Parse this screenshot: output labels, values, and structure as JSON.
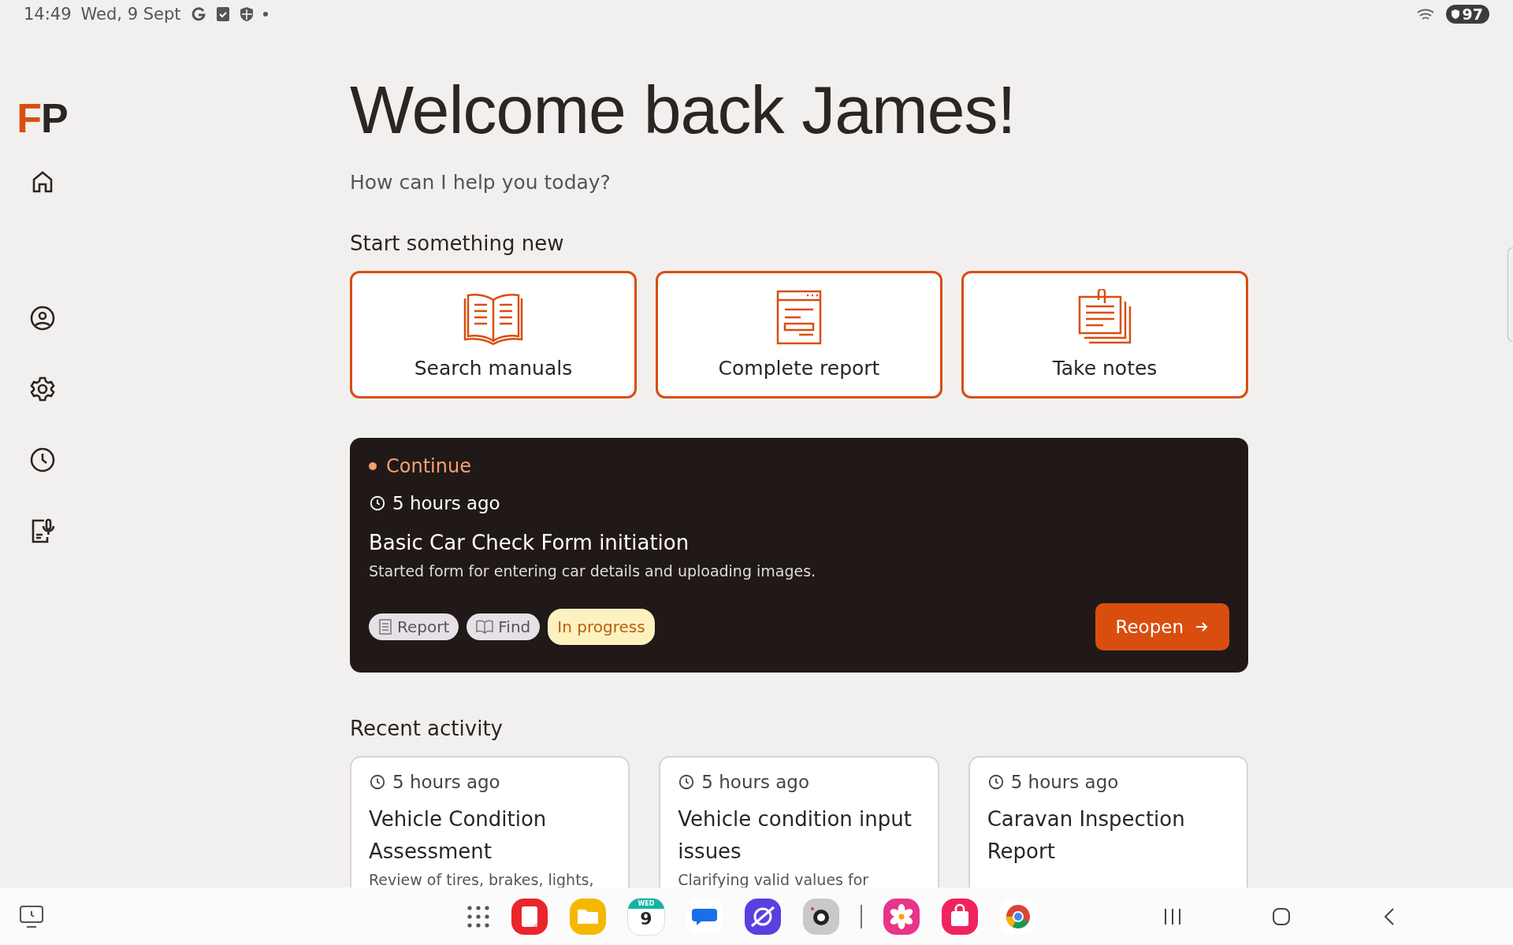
{
  "status_bar": {
    "time": "14:49",
    "date": "Wed, 9 Sept",
    "battery": "97"
  },
  "sidebar": {
    "logo_first": "F",
    "logo_second": "P"
  },
  "heading": "Welcome back James!",
  "subheading": "How can I help you today?",
  "start_section": {
    "title": "Start something new",
    "actions": [
      {
        "kind": "manuals",
        "label": "Search manuals"
      },
      {
        "kind": "report",
        "label": "Complete report"
      },
      {
        "kind": "notes",
        "label": "Take notes"
      }
    ]
  },
  "continue": {
    "label": "Continue",
    "time": "5 hours ago",
    "title": "Basic Car Check Form initiation",
    "description": "Started form for entering car details and uploading images.",
    "tags": [
      {
        "kind": "report",
        "label": "Report"
      },
      {
        "kind": "find",
        "label": "Find"
      },
      {
        "kind": "status",
        "label": "In progress"
      }
    ],
    "button": "Reopen"
  },
  "recent": {
    "title": "Recent activity",
    "items": [
      {
        "time": "5 hours ago",
        "title": "Vehicle Condition Assessment",
        "description": "Review of tires, brakes, lights,"
      },
      {
        "time": "5 hours ago",
        "title": "Vehicle condition input issues",
        "description": "Clarifying valid values for"
      },
      {
        "time": "5 hours ago",
        "title": "Caravan Inspection Report"
      }
    ]
  },
  "taskbar": {
    "calendar_day": "WED",
    "calendar_date": "9"
  }
}
